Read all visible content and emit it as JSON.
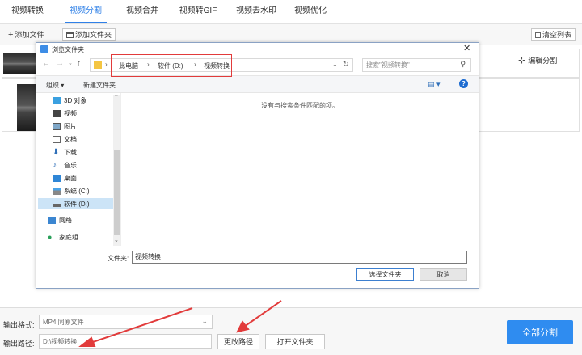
{
  "tabs": [
    {
      "label": "视频转换",
      "active": false
    },
    {
      "label": "视频分割",
      "active": true
    },
    {
      "label": "视频合并",
      "active": false
    },
    {
      "label": "视频转GIF",
      "active": false
    },
    {
      "label": "视频去水印",
      "active": false
    },
    {
      "label": "视频优化",
      "active": false
    }
  ],
  "toolbar": {
    "add_file": "添加文件",
    "add_folder": "添加文件夹",
    "clear_list": "清空列表"
  },
  "list": {
    "edit_split": "编辑分割"
  },
  "dialog": {
    "title": "浏览文件夹",
    "breadcrumb": [
      "此电脑",
      "软件 (D:)",
      "视频转换"
    ],
    "search_placeholder": "搜索\"视频转换\"",
    "organize": "组织 ▾",
    "new_folder": "新建文件夹",
    "empty_message": "没有与搜索条件匹配的项。",
    "nav_items": [
      "3D 对象",
      "视频",
      "图片",
      "文档",
      "下载",
      "音乐",
      "桌面",
      "系统 (C:)",
      "软件 (D:)"
    ],
    "network": "网络",
    "homegroup": "家庭组",
    "folder_label": "文件夹:",
    "folder_value": "视频转换",
    "select_button": "选择文件夹",
    "cancel_button": "取消"
  },
  "bottom": {
    "format_label": "输出格式:",
    "format_value": "MP4  同原文件",
    "path_label": "输出路径:",
    "path_value": "D:\\视频转换",
    "change_path": "更改路径",
    "open_folder": "打开文件夹",
    "split_all": "全部分割"
  },
  "colors": {
    "accent": "#2f80e7",
    "primary_button": "#2f8cf0",
    "annotation_red": "#e23b3b"
  }
}
